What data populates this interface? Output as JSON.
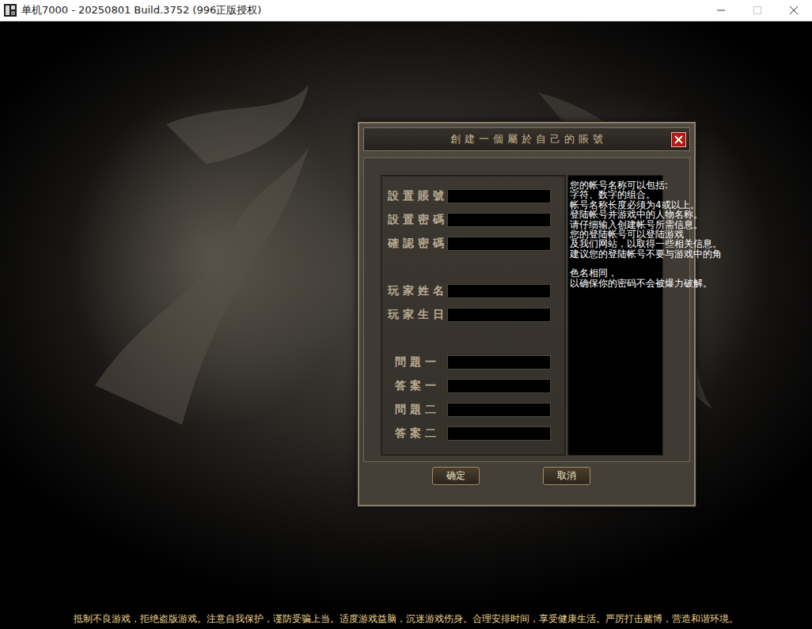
{
  "window": {
    "title": "单机7000 - 20250801 Build.3752 (996正版授权)"
  },
  "dialog": {
    "title": "創建一個屬於自己的賬號",
    "field_groups": [
      [
        {
          "label": "設置賬號",
          "value": ""
        },
        {
          "label": "設置密碼",
          "value": ""
        },
        {
          "label": "確認密碼",
          "value": ""
        }
      ],
      [
        {
          "label": "玩家姓名",
          "value": ""
        },
        {
          "label": "玩家生日",
          "value": ""
        }
      ],
      [
        {
          "label": "問題一",
          "value": ""
        },
        {
          "label": "答案一",
          "value": ""
        },
        {
          "label": "問題二",
          "value": ""
        },
        {
          "label": "答案二",
          "value": ""
        }
      ]
    ],
    "info": [
      [
        "您的帐号名称可以包括:",
        "字符、数字的组合。",
        "帐号名称长度必须为4或以上。",
        "登陆帐号并游戏中的人物名称。",
        "请仔细输入创建帐号所需信息。",
        "您的登陆帐号可以登陆游戏",
        "及我们网站，以取得一些相关信息。",
        "建议您的登陆帐号不要与游戏中的角"
      ],
      [
        "色名相同，",
        "以确保你的密码不会被爆力破解。"
      ]
    ],
    "buttons": [
      "确定",
      "取消"
    ]
  },
  "footer": "抵制不良游戏，拒绝盗版游戏。注意自我保护，谨防受骗上当。适度游戏益脑，沉迷游戏伤身。合理安排时间，享受健康生活。严厉打击赌博，营造和谐环境。"
}
